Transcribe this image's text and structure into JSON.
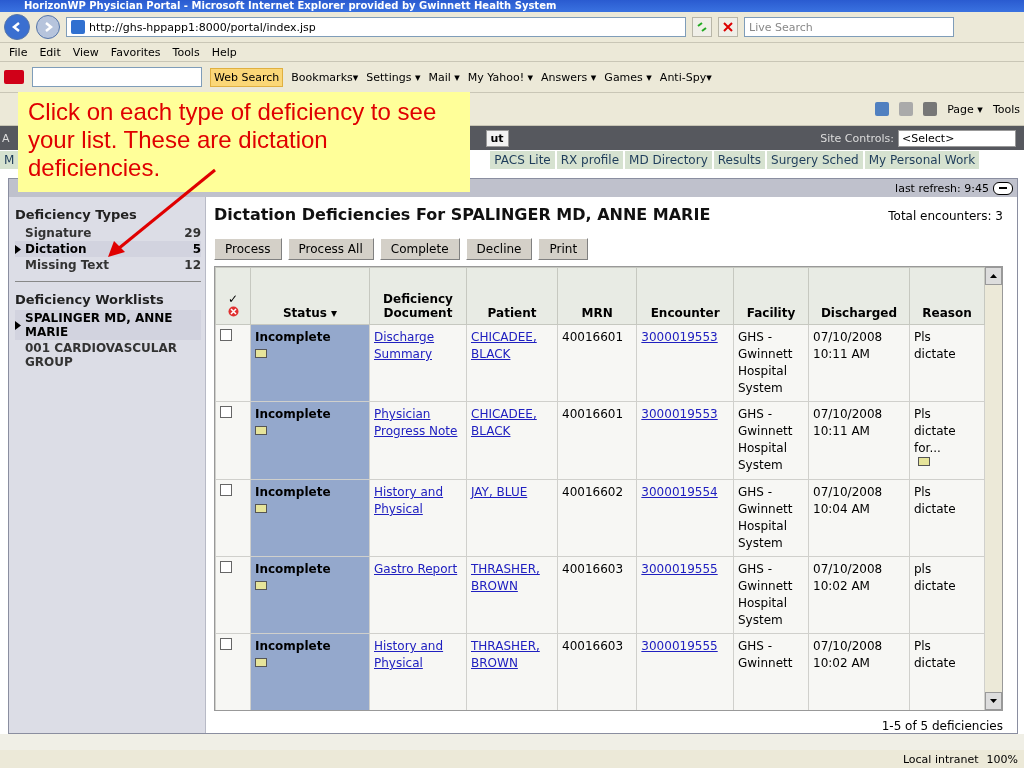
{
  "window": {
    "title": "HorizonWP Physician Portal - Microsoft Internet Explorer provided by Gwinnett Health System"
  },
  "address_bar": {
    "url": "http://ghs-hppapp1:8000/portal/index.jsp",
    "search_placeholder": "Live Search"
  },
  "menu": [
    "File",
    "Edit",
    "View",
    "Favorites",
    "Tools",
    "Help"
  ],
  "yahoo_toolbar": {
    "search_button": "Web Search",
    "items": [
      "Bookmarks▾",
      "Settings ▾",
      "Mail ▾",
      "My Yahoo! ▾",
      "Answers ▾",
      "Games ▾",
      "Anti-Spy▾"
    ]
  },
  "command_bar": [
    "Page ▾",
    "Tools"
  ],
  "portal_header": {
    "left": "A",
    "button": "ut",
    "site_controls_label": "Site Controls:",
    "site_controls_value": "<Select>"
  },
  "nav": [
    {
      "label": "M"
    },
    {
      "label": "PACS Lite"
    },
    {
      "label": "RX profile"
    },
    {
      "label": "MD Directory"
    },
    {
      "label": "Results"
    },
    {
      "label": "Surgery Sched"
    },
    {
      "label": "My Personal Work"
    }
  ],
  "portlet": {
    "refresh": "last refresh: 9:45"
  },
  "sidebar": {
    "types_title": "Deficiency Types",
    "types": [
      {
        "label": "Signature",
        "count": "29",
        "selected": false
      },
      {
        "label": "Dictation",
        "count": "5",
        "selected": true
      },
      {
        "label": "Missing Text",
        "count": "12",
        "selected": false
      }
    ],
    "worklists_title": "Deficiency Worklists",
    "worklists": [
      {
        "label": "SPALINGER MD, ANNE MARIE",
        "selected": true
      },
      {
        "label": "001 CARDIOVASCULAR GROUP",
        "selected": false
      }
    ]
  },
  "main": {
    "title": "Dictation Deficiencies For SPALINGER MD, ANNE MARIE",
    "total": "Total encounters: 3",
    "buttons": [
      "Process",
      "Process All",
      "Complete",
      "Decline",
      "Print"
    ],
    "check_header": "✓",
    "columns": [
      "Status ▾",
      "Deficiency Document",
      "Patient",
      "MRN",
      "Encounter",
      "Facility",
      "Discharged",
      "Reason"
    ],
    "rows": [
      {
        "checked": false,
        "status": "Incomplete",
        "document": "Discharge Summary",
        "patient": "CHICADEE, BLACK",
        "mrn": "40016601",
        "encounter": "3000019553",
        "facility": "GHS - Gwinnett Hospital System",
        "discharged": "07/10/2008 10:11 AM",
        "reason": "Pls dictate",
        "reason_note": false
      },
      {
        "checked": false,
        "status": "Incomplete",
        "document": "Physician Progress Note",
        "patient": "CHICADEE, BLACK",
        "mrn": "40016601",
        "encounter": "3000019553",
        "facility": "GHS - Gwinnett Hospital System",
        "discharged": "07/10/2008 10:11 AM",
        "reason": "Pls dictate for...",
        "reason_note": true
      },
      {
        "checked": false,
        "status": "Incomplete",
        "document": "History and Physical",
        "patient": "JAY, BLUE",
        "mrn": "40016602",
        "encounter": "3000019554",
        "facility": "GHS - Gwinnett Hospital System",
        "discharged": "07/10/2008 10:04 AM",
        "reason": "Pls dictate",
        "reason_note": false
      },
      {
        "checked": false,
        "status": "Incomplete",
        "document": "Gastro Report",
        "patient": "THRASHER, BROWN",
        "mrn": "40016603",
        "encounter": "3000019555",
        "facility": "GHS - Gwinnett Hospital System",
        "discharged": "07/10/2008 10:02 AM",
        "reason": "pls dictate",
        "reason_note": false
      },
      {
        "checked": false,
        "status": "Incomplete",
        "document": "History and Physical",
        "patient": "THRASHER, BROWN",
        "mrn": "40016603",
        "encounter": "3000019555",
        "facility": "GHS - Gwinnett",
        "discharged": "07/10/2008 10:02 AM",
        "reason": "Pls dictate",
        "reason_note": false
      }
    ],
    "footer": "1-5 of 5 deficiencies"
  },
  "callout": {
    "text": "Click on each type of deficiency to see your list. These are dictation deficiencies."
  },
  "status_bar": {
    "zone": "Local intranet",
    "zoom": "100%"
  }
}
